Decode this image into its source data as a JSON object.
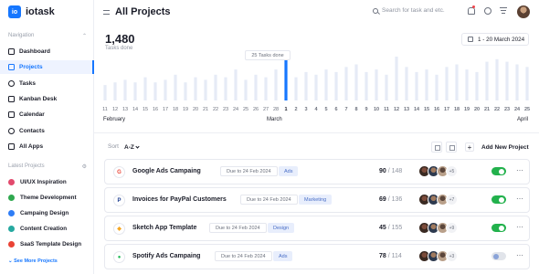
{
  "app": {
    "name": "iotask",
    "logo_letters": "io"
  },
  "sidebar": {
    "nav_heading": "Navigation",
    "nav_items": [
      {
        "label": "Dashboard",
        "icon": "dashboard-icon"
      },
      {
        "label": "Projects",
        "icon": "folder-icon",
        "active": true
      },
      {
        "label": "Tasks",
        "icon": "tasks-icon"
      },
      {
        "label": "Kanban Desk",
        "icon": "kanban-icon"
      },
      {
        "label": "Calendar",
        "icon": "calendar-icon"
      },
      {
        "label": "Contacts",
        "icon": "contacts-icon"
      },
      {
        "label": "All Apps",
        "icon": "apps-icon"
      }
    ],
    "projects_heading": "Latest Projects",
    "projects": [
      {
        "label": "UI/UX Inspiration",
        "color": "#e24a6d"
      },
      {
        "label": "Theme Development",
        "color": "#2fa84f"
      },
      {
        "label": "Campaing Design",
        "color": "#2e7df6"
      },
      {
        "label": "Content Creation",
        "color": "#26a9a0"
      },
      {
        "label": "SaaS Template Design",
        "color": "#ea4335"
      }
    ],
    "see_more": "See More Projects"
  },
  "header": {
    "title": "All Projects",
    "search_placeholder": "Search for task and etc.",
    "accent": "#1677ff"
  },
  "stats": {
    "value": "1,480",
    "label": "Tasks done",
    "date_range": "1 - 20 March 2024",
    "tooltip": "25 Tasks done"
  },
  "chart_data": {
    "type": "bar",
    "categories": [
      "11",
      "12",
      "13",
      "14",
      "15",
      "16",
      "17",
      "18",
      "19",
      "20",
      "21",
      "22",
      "23",
      "24",
      "25",
      "26",
      "27",
      "28",
      "1",
      "2",
      "3",
      "4",
      "5",
      "6",
      "7",
      "8",
      "9",
      "10",
      "11",
      "12",
      "13",
      "14",
      "15",
      "16",
      "17",
      "18",
      "19",
      "20",
      "21",
      "22",
      "23",
      "24",
      "25"
    ],
    "values": [
      6,
      7,
      8,
      7,
      9,
      7,
      8,
      10,
      7,
      9,
      8,
      10,
      9,
      12,
      8,
      10,
      9,
      12,
      16,
      9,
      11,
      10,
      12,
      11,
      13,
      14,
      11,
      12,
      10,
      17,
      13,
      11,
      12,
      10,
      13,
      14,
      12,
      11,
      15,
      16,
      15,
      14,
      13
    ],
    "highlight_index": 18,
    "months": [
      "February",
      "March",
      "April"
    ],
    "colors": {
      "bar": "#e6ebf6",
      "highlight": "#1677ff"
    }
  },
  "toolbar": {
    "sort_label": "Sort",
    "sort_value": "A-Z",
    "add_project": "Add New Project"
  },
  "projects": [
    {
      "name": "Google Ads Campaing",
      "logo": "G",
      "logo_color": "#ea4335",
      "due": "Due to 24 Feb 2024",
      "tag": "Ads",
      "done": "90",
      "total": "148",
      "more": "+5",
      "enabled": true
    },
    {
      "name": "Invoices for PayPal Customers",
      "logo": "P",
      "logo_color": "#1c3d8f",
      "due": "Due to 24 Feb 2024",
      "tag": "Marketing",
      "done": "69",
      "total": "136",
      "more": "+7",
      "enabled": true
    },
    {
      "name": "Sketch App Template",
      "logo": "◆",
      "logo_color": "#f5a623",
      "due": "Due to 24 Feb 2024",
      "tag": "Design",
      "done": "45",
      "total": "155",
      "more": "+9",
      "enabled": true
    },
    {
      "name": "Spotify Ads Campaing",
      "logo": "●",
      "logo_color": "#1db954",
      "due": "Due to 24 Feb 2024",
      "tag": "Ads",
      "done": "78",
      "total": "114",
      "more": "+3",
      "enabled": false
    }
  ]
}
